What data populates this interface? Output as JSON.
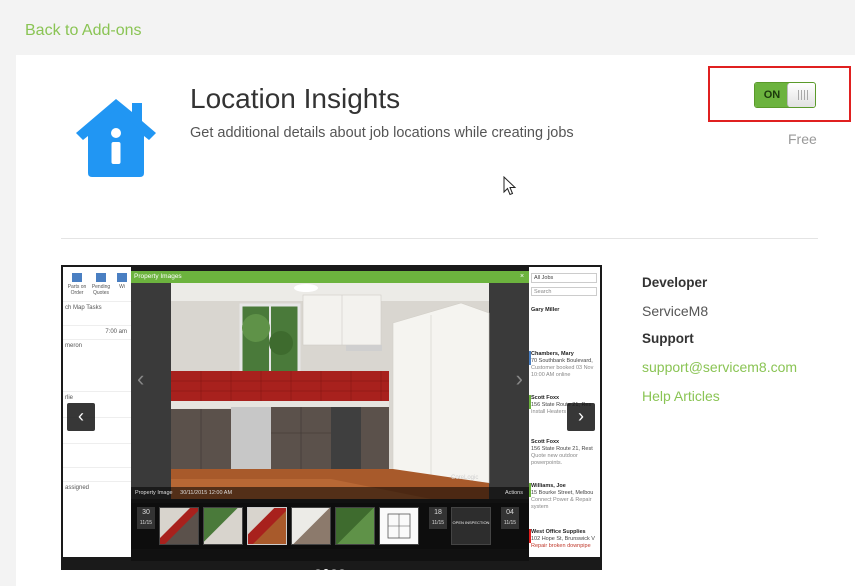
{
  "nav": {
    "back_label": "Back to Add-ons"
  },
  "addon": {
    "title": "Location Insights",
    "subtitle": "Get additional details about job locations while creating jobs",
    "toggle_label": "ON",
    "price": "Free",
    "icon": "house-info-icon"
  },
  "screenshot": {
    "modal_title": "Property Images",
    "close_glyph": "×",
    "photo_caption": "Property Image",
    "photo_date": "30/11/2015 12:00 AM",
    "photo_watermark": "CoreLogic",
    "photo_actions": "Actions",
    "toolbar": [
      {
        "label": "Parts on Order"
      },
      {
        "label": "Pending Quotes"
      },
      {
        "label": "Wi"
      }
    ],
    "left_rows": [
      "ch Map",
      "Tasks",
      "7:00 am",
      "meron",
      "rlie",
      "",
      "",
      "",
      "",
      "assigned"
    ],
    "left_tabs_label": "ch Map  Tasks",
    "filter_label": "All Jobs",
    "search_placeholder": "Search",
    "jobs": [
      {
        "name": "Gary Miller",
        "line1": "",
        "line2": ""
      },
      {
        "name": "Chambers, Mary",
        "line1": "70 Southbank Boulevard,",
        "line2": "Customer booked 03 Nov 10:00 AM online"
      },
      {
        "name": "Scott Foxx",
        "line1": "156 State Route 21, Res",
        "line2": "Install Heaters"
      },
      {
        "name": "Scott Foxx",
        "line1": "156 State Route 21, Rest",
        "line2": "Quote new outdoor powerpoints."
      },
      {
        "name": "Williams, Joe",
        "line1": "15 Bourke Street, Melbou",
        "line2": "Connect Power & Repair system"
      },
      {
        "name": "West Office Supplies",
        "line1": "102 Hope St, Brunswick V",
        "line2": "Repair broken downpipe"
      }
    ],
    "thumb_dates": [
      {
        "day": "30",
        "month": "11/15"
      },
      {
        "day": "18",
        "month": "11/15"
      },
      {
        "day": "04",
        "month": "11/15"
      }
    ],
    "thumb_sign": "OPEN INSPECTION",
    "prev_glyph": "‹",
    "next_glyph": "›",
    "slide_count": 4,
    "active_slide": 1
  },
  "developer": {
    "developer_label": "Developer",
    "developer_name": "ServiceM8",
    "support_label": "Support",
    "support_email": "support@servicem8.com",
    "help_link": "Help Articles"
  },
  "colors": {
    "accent_green": "#8ac454",
    "toggle_green": "#6cb33e",
    "icon_blue": "#2196f3",
    "highlight_red": "#e02020"
  }
}
